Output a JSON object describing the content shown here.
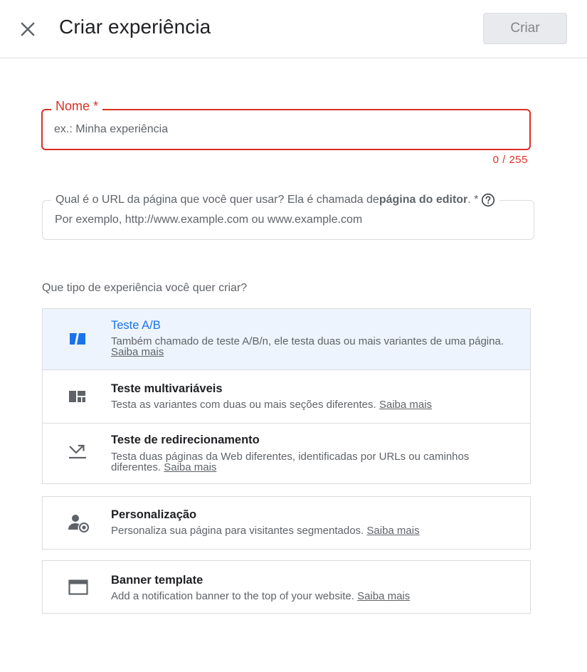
{
  "header": {
    "title": "Criar experiência",
    "create_label": "Criar"
  },
  "name_field": {
    "label": "Nome *",
    "placeholder": "ex.: Minha experiência",
    "value": "",
    "counter": "0 / 255"
  },
  "url_field": {
    "label_prefix": "Qual é o URL da página que você quer usar? Ela é chamada de ",
    "label_bold": "página do editor",
    "label_suffix": ". *",
    "placeholder": "Por exemplo, http://www.example.com ou www.example.com",
    "value": ""
  },
  "section_question": "Que tipo de experiência você quer criar?",
  "learn_more": "Saiba mais",
  "options": [
    {
      "icon": "ab-test-icon",
      "title": "Teste A/B",
      "desc": "Também chamado de teste A/B/n, ele testa duas ou mais variantes de uma página.",
      "selected": true
    },
    {
      "icon": "multivariate-icon",
      "title": "Teste multivariáveis",
      "desc": "Testa as variantes com duas ou mais seções diferentes.",
      "selected": false
    },
    {
      "icon": "redirect-icon",
      "title": "Teste de redirecionamento",
      "desc": "Testa duas páginas da Web diferentes, identificadas por URLs ou caminhos diferentes.",
      "selected": false
    },
    {
      "icon": "personalization-icon",
      "title": "Personalização",
      "desc": "Personaliza sua página para visitantes segmentados.",
      "selected": false
    },
    {
      "icon": "banner-icon",
      "title": "Banner template",
      "desc": "Add a notification banner to the top of your website.",
      "selected": false
    }
  ],
  "colors": {
    "error": "#d93025",
    "accent": "#1a73e8",
    "selected_bg": "#eef4fd",
    "border": "#dadce0"
  }
}
